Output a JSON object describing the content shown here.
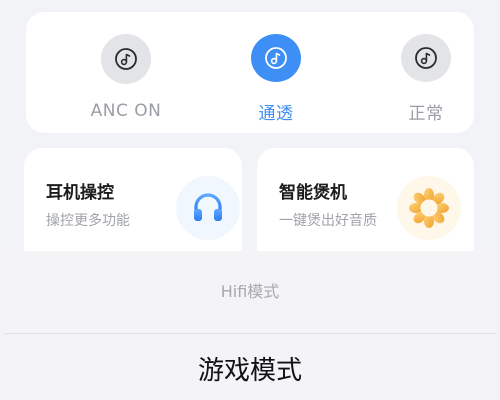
{
  "noise_modes": [
    {
      "label": "ANC ON",
      "icon": "music-note-icon",
      "active": false
    },
    {
      "label": "通透",
      "icon": "music-note-icon",
      "active": true
    },
    {
      "label": "正常",
      "icon": "music-note-icon",
      "active": false
    }
  ],
  "features": [
    {
      "title": "耳机操控",
      "subtitle": "操控更多功能",
      "icon": "headphones-icon"
    },
    {
      "title": "智能煲机",
      "subtitle": "一键煲出好音质",
      "icon": "burn-in-flower-icon"
    }
  ],
  "sheet": {
    "options": [
      "Hifi模式",
      "游戏模式"
    ]
  },
  "colors": {
    "accent": "#3d8ff5",
    "inactive_circle": "#e3e4e8",
    "headphones": "#3d8ff5",
    "burn_in": "#f3b43f"
  }
}
